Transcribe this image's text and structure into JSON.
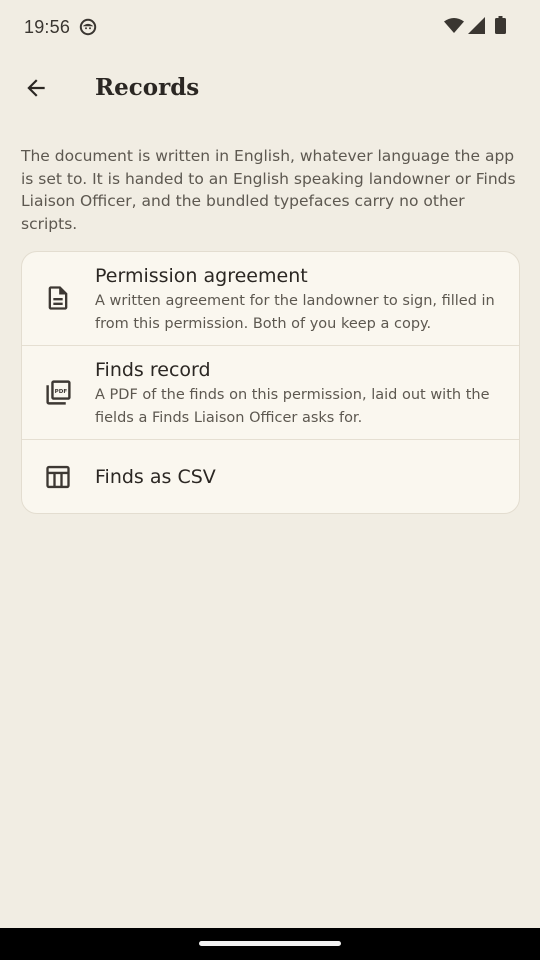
{
  "status_bar": {
    "time": "19:56",
    "left_icon": "smiley-icon",
    "right_icons": [
      "wifi-icon",
      "cell-signal-icon",
      "battery-icon"
    ]
  },
  "app_bar": {
    "back_icon": "arrow-back-icon",
    "title": "Records"
  },
  "intro": "The document is written in English, whatever language the app is set to. It is handed to an English speaking landowner or Finds Liaison Officer, and the bundled typefaces carry no other scripts.",
  "records": [
    {
      "icon": "document-icon",
      "title": "Permission agreement",
      "subtitle": "A written agreement for the landowner to sign, filled in from this permission. Both of you keep a copy."
    },
    {
      "icon": "pdf-icon",
      "title": "Finds record",
      "subtitle": "A PDF of the finds on this permission, laid out with the fields a Finds Liaison Officer asks for."
    },
    {
      "icon": "table-icon",
      "title": "Finds as CSV"
    }
  ],
  "colors": {
    "background": "#f1ede3",
    "card": "#faf7ef",
    "text_primary": "#2b2723",
    "text_secondary": "#5d5850",
    "icon": "#3d3833",
    "nav_bar": "#000000"
  }
}
